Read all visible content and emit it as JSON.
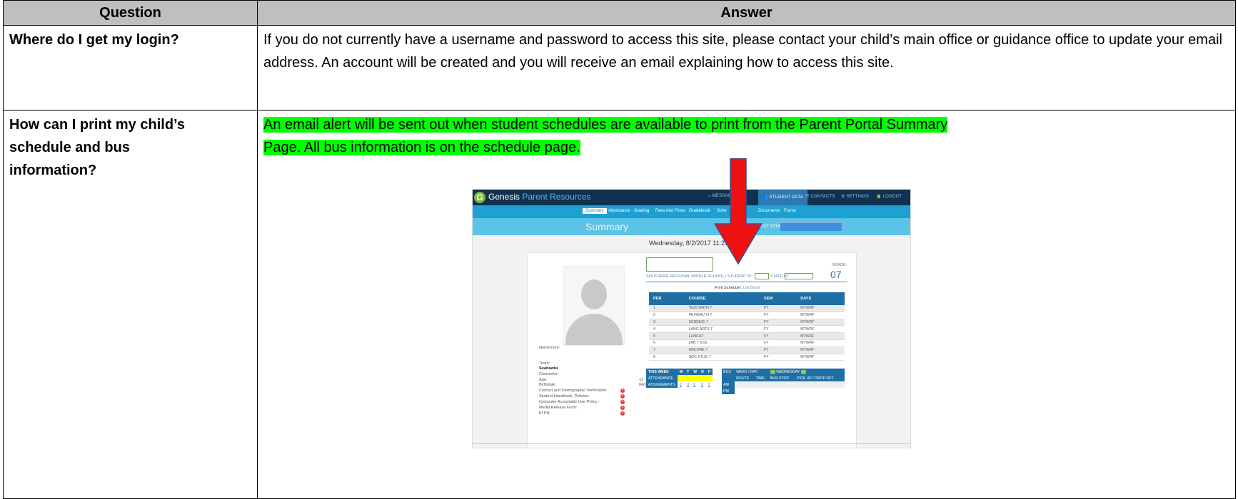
{
  "headers": {
    "question": "Question",
    "answer": "Answer"
  },
  "rows": [
    {
      "question": "Where do I get my login?",
      "answer": "If you do not currently have a username and password to access this site, please contact your child’s main office or guidance office to update your email address.  An account will be created and you will receive an email explaining how to access this site."
    },
    {
      "question_lines": [
        "How can I print my child’s",
        "schedule and bus",
        "information?"
      ],
      "answer_lines": [
        "An email alert will be sent out when student schedules are available to print from the Parent Portal Summary",
        "Page. All bus information is on the schedule page."
      ],
      "highlight_color": "#00ff00"
    }
  ],
  "screenshot": {
    "brand_logo": "G",
    "brand": "Genesis",
    "brand_suffix": "Parent Resources",
    "top_nav": [
      "⌂ MESSAGES",
      "👥 STUDENT DATA",
      "☰ CONTACTS",
      "⚙ SETTINGS",
      "🔒 LOGOUT"
    ],
    "sub_nav": [
      "Summary",
      "Attendance",
      "Grading",
      "Fees And Fines",
      "Gradebook",
      "Sche",
      "Documents",
      "Forms"
    ],
    "page_title": "Summary",
    "select_student_label": "LECT STUDENT:",
    "date": "Wednesday, 8/2/2017 11:21AM",
    "school": "SOUTHERN REGIONAL MIDDLE SCHOOL  |  STUDENT ID:",
    "state_id_label": "STATE ID:",
    "grade_label": "GRADE:",
    "grade": "07",
    "print_schedule": "Print Schedule:",
    "print_list": "List",
    "print_block": "Block",
    "schedule_headers": [
      "PER",
      "COURSE",
      "SEM",
      "DAYS"
    ],
    "schedule": [
      [
        "1",
        "*ESS MATH 7",
        "FY",
        "MTWRF"
      ],
      [
        "2",
        "PE/HEALTH 7",
        "FY",
        "MTWRF"
      ],
      [
        "3",
        "SCIENCE 7",
        "FY",
        "MTWRF"
      ],
      [
        "4",
        "LANG ARTS 7",
        "FY",
        "MTWRF"
      ],
      [
        "5",
        "LUNCH7",
        "FY",
        "MTWRF"
      ],
      [
        "6",
        "LAB 7 ESS",
        "FY",
        "MTWRF"
      ],
      [
        "7",
        "ENCORE 7",
        "FY",
        "MTWRF"
      ],
      [
        "8",
        "SOC STUD 7",
        "FY",
        "MTWRF"
      ]
    ],
    "info": {
      "homeroom": "Homeroom:",
      "team": "Team:",
      "team_value": "Seahawks",
      "counselor": "Counselor:",
      "age": "Age:",
      "age_value": "12",
      "birthdate": "Birthdate:",
      "birthdate_value": "04/25/2005",
      "forms": [
        "Contact and Demographic Verification:",
        "Student Handbook, Policies:",
        "Computer Acceptable Use Policy :",
        "Media Release Form:",
        "KI Pill:"
      ]
    },
    "week": {
      "title": "THIS WEEK",
      "days": [
        "M",
        "T",
        "W",
        "R",
        "F"
      ],
      "attendance": "ATTENDANCE",
      "assignments": "ASSIGNMENTS",
      "counts": [
        "0",
        "0",
        "0",
        "0",
        "0"
      ]
    },
    "bus": {
      "title": "BUS",
      "view": "WEEK / DAY",
      "day": "WEDNESDAY",
      "headers": [
        "ROUTE",
        "TIME",
        "BUS STOP",
        "PICK UP / DROP OFF"
      ],
      "am": "AM",
      "pm": "PM"
    }
  },
  "colors": {
    "header_bg": "#bfbfbf",
    "highlight": "#00ff00",
    "arrow": "#ee1111",
    "genesis_nav": "#10314f",
    "genesis_sub": "#1fa0d2"
  }
}
